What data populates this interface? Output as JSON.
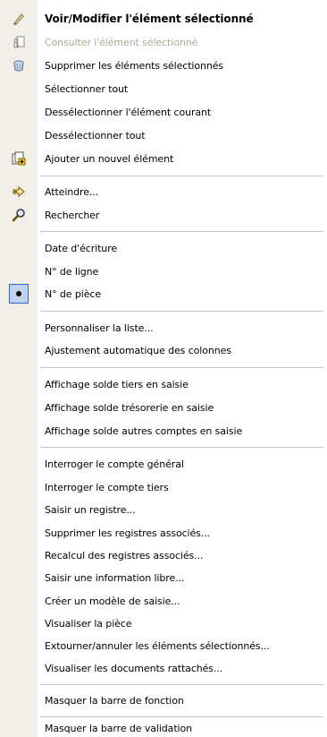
{
  "menu": {
    "items": [
      {
        "label": "Voir/Modifier l'élément sélectionné",
        "icon": "pencil-icon",
        "bold": true
      },
      {
        "label": "Consulter l'élément sélectionné",
        "icon": "consult-icon",
        "disabled": true
      },
      {
        "label": "Supprimer les éléments sélectionnés",
        "icon": "trash-icon"
      },
      {
        "label": "Sélectionner tout"
      },
      {
        "label": "Dessélectionner l'élément courant"
      },
      {
        "label": "Dessélectionner tout"
      },
      {
        "label": "Ajouter un nouvel élément",
        "icon": "add-item-icon"
      },
      {
        "label": "Atteindre...",
        "icon": "goto-icon"
      },
      {
        "label": "Rechercher",
        "icon": "search-icon"
      },
      {
        "label": "Date d'écriture"
      },
      {
        "label": "N° de ligne"
      },
      {
        "label": "N° de pièce",
        "checked": true
      },
      {
        "label": "Personnaliser la liste..."
      },
      {
        "label": "Ajustement automatique des colonnes"
      },
      {
        "label": "Affichage solde tiers en saisie"
      },
      {
        "label": "Affichage solde trésorerie en saisie"
      },
      {
        "label": "Affichage solde autres comptes en saisie"
      },
      {
        "label": "Interroger le compte général"
      },
      {
        "label": "Interroger le compte tiers"
      },
      {
        "label": "Saisir un registre..."
      },
      {
        "label": "Supprimer les registres associés..."
      },
      {
        "label": "Recalcul des registres associés..."
      },
      {
        "label": "Saisir une information libre..."
      },
      {
        "label": "Créer un modèle de saisie..."
      },
      {
        "label": "Visualiser la pièce"
      },
      {
        "label": "Extourner/annuler les éléments sélectionnés..."
      },
      {
        "label": "Visualiser les documents rattachés..."
      },
      {
        "label": "Masquer la barre de fonction"
      },
      {
        "label": "Masquer la barre de validation"
      }
    ]
  },
  "colors": {
    "gutter": "#f1efe7",
    "disabled_text": "#aca899",
    "separator": "#c5c2b8",
    "checked_bg": "#c1d2ee",
    "checked_border": "#316ac5"
  }
}
